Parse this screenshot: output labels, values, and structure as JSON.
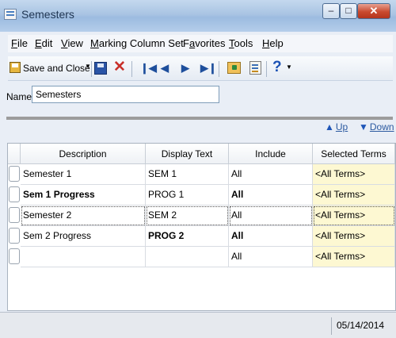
{
  "window": {
    "title": "Semesters"
  },
  "menu": [
    {
      "pre": "",
      "u": "F",
      "post": "ile"
    },
    {
      "pre": "",
      "u": "E",
      "post": "dit"
    },
    {
      "pre": "",
      "u": "V",
      "post": "iew"
    },
    {
      "pre": "",
      "u": "M",
      "post": "arking Column Set"
    },
    {
      "pre": "F",
      "u": "a",
      "post": "vorites"
    },
    {
      "pre": "",
      "u": "T",
      "post": "ools"
    },
    {
      "pre": "",
      "u": "H",
      "post": "elp"
    }
  ],
  "toolbar": {
    "save_close_label": "Save and Close"
  },
  "form": {
    "name_label": "Name:",
    "name_value": "Semesters"
  },
  "band": {
    "up_label": "Up",
    "down_label": "Down"
  },
  "grid": {
    "headers": [
      "Description",
      "Display Text",
      "Include",
      "Selected Terms"
    ],
    "rows": [
      {
        "description": "Semester 1",
        "display": "SEM 1",
        "include": "All",
        "terms": "<All Terms>"
      },
      {
        "description": "Sem 1 Progress",
        "display": "PROG 1",
        "include": "All",
        "terms": "<All Terms>"
      },
      {
        "description": "Semester 2",
        "display": "SEM 2",
        "include": "All",
        "terms": "<All Terms>"
      },
      {
        "description": "Sem 2 Progress",
        "display": "PROG 2",
        "include": "All",
        "terms": "<All Terms>"
      },
      {
        "description": "",
        "display": "",
        "include": "All",
        "terms": "<All Terms>"
      }
    ]
  },
  "status": {
    "date": "05/14/2014"
  },
  "colors": {
    "titlebar": "#a9c4e3",
    "close": "#c94a2f",
    "band": "#9c9c9c",
    "terms_bg": "#fdf8d2",
    "accent": "#1e4f9c"
  }
}
